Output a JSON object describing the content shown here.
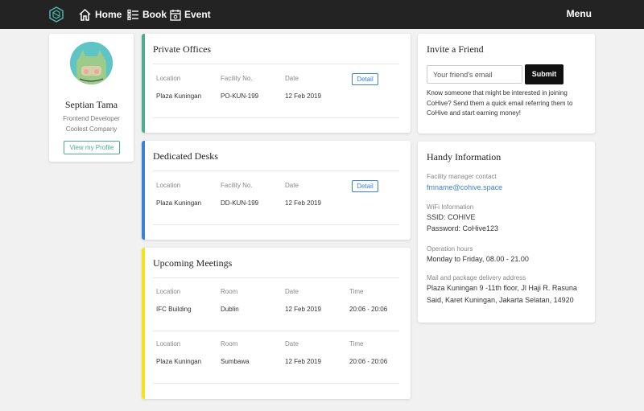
{
  "nav": {
    "home": "Home",
    "book": "Book",
    "event": "Event",
    "menu": "Menu"
  },
  "profile": {
    "name": "Septian Tama",
    "role": "Frontend Developer",
    "company": "Coolest Company",
    "button": "View my Profile"
  },
  "private_offices": {
    "title": "Private Offices",
    "headers": [
      "Location",
      "Facility No.",
      "Date"
    ],
    "row": {
      "location": "Plaza Kuningan",
      "facility": "PO-KUN-199",
      "date": "12 Feb 2019"
    },
    "detail": "Detail",
    "accent": "#4cae8e"
  },
  "dedicated_desks": {
    "title": "Dedicated Desks",
    "headers": [
      "Location",
      "Facility No.",
      "Date"
    ],
    "row": {
      "location": "Plaza Kuningan",
      "facility": "DD-KUN-199",
      "date": "12 Feb 2019"
    },
    "detail": "Detail",
    "accent": "#3b82d6"
  },
  "upcoming_meetings": {
    "title": "Upcoming Meetings",
    "headers": [
      "Location",
      "Room",
      "Date",
      "Time"
    ],
    "rows": [
      {
        "location": "IFC Building",
        "room": "Dublin",
        "date": "12 Feb 2019",
        "time": "20:06 - 20:06"
      },
      {
        "location": "Plaza Kuningan",
        "room": "Sumbawa",
        "date": "12 Feb 2019",
        "time": "20:06 - 20:06"
      }
    ],
    "accent": "#f5e31a"
  },
  "invite": {
    "title": "Invite a Friend",
    "placeholder": "Your friend's email",
    "submit": "Submit",
    "text": "Know someone that might be interested in joining CoHive? Send them a quick email referring them to CoHive and start earning money!"
  },
  "handy": {
    "title": "Handy Information",
    "fm_label": "Facility manager contact",
    "fm_email": "fmname@cohive.space",
    "wifi_label": "WiFi Information",
    "wifi_ssid": "SSID: COHIVE",
    "wifi_password": "Password: CoHive123",
    "hours_label": "Operation hours",
    "hours": "Monday to Friday, 08.00 - 21.00",
    "mail_label": "Mail and package delivery address",
    "mail_address": "Plaza Kuningan 9 -11th floor, Jl Haji R. Rasuna Said, Karet Kuningan, Jakarta Selatan, 14920"
  }
}
